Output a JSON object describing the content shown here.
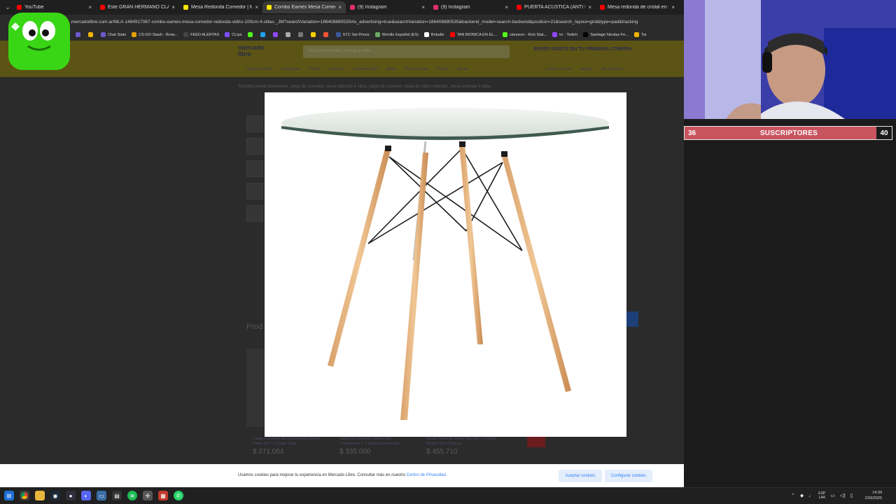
{
  "browser": {
    "tabs": [
      {
        "title": "YouTube",
        "color": "#ff0000"
      },
      {
        "title": "Este GRAN HERMANO CLANDE...",
        "color": "#ff0000"
      },
      {
        "title": "Mesa Redonda Comedor | Mer...",
        "color": "#ffe600"
      },
      {
        "title": "Combo Eames Mesa Comedor...",
        "color": "#ffe600",
        "active": true
      },
      {
        "title": "(9) Instagram",
        "color": "#e1306c"
      },
      {
        "title": "(9) Instagram",
        "color": "#e1306c"
      },
      {
        "title": "PUERTA ACÚSTICA (ANTI RUID...",
        "color": "#ff0000"
      },
      {
        "title": "Mesa redonda de cristal en liqu...",
        "color": "#ff0000"
      }
    ],
    "url": ".mercadolibre.com.ar/MLA-1464917067-combo-eames-mesa-comedor-redonda-vidrio-100cm-4-sillas-_JM?searchVariation=186408880535#is_advertising=true&searchVariation=186408880535&backend_model=search-backend&position=21&search_layout=grid&type=pad&tracking",
    "bookmarks": [
      {
        "label": "",
        "color": "#6a5acd"
      },
      {
        "label": "",
        "color": "#f0b400"
      },
      {
        "label": "Chat Stats",
        "color": "#6a5acd"
      },
      {
        "label": "CS:GO Stash - Brow...",
        "color": "#e0a000"
      },
      {
        "label": "FEED ALERTAS",
        "color": "#444"
      },
      {
        "label": "CLips",
        "color": "#7c4dff"
      },
      {
        "label": "",
        "color": "#53fc18"
      },
      {
        "label": "",
        "color": "#1da1f2"
      },
      {
        "label": "",
        "color": "#9146ff"
      },
      {
        "label": "",
        "color": "#aaaaaa"
      },
      {
        "label": "",
        "color": "#777777"
      },
      {
        "label": "",
        "color": "#ffd000"
      },
      {
        "label": "",
        "color": "#ff5533"
      },
      {
        "label": "STC Set Prices",
        "color": "#3b5998"
      },
      {
        "label": "Wordle Español (ES)",
        "color": "#6aaa64"
      },
      {
        "label": "Boludle",
        "color": "#ffffff"
      },
      {
        "label": "TAN BIONICA EN EL...",
        "color": "#ff0000"
      },
      {
        "label": "cionaron - Kick Stat...",
        "color": "#53fc18"
      },
      {
        "label": "trr - Twitch",
        "color": "#9146ff"
      },
      {
        "label": "Santiago Nicolas Fe...",
        "color": "#000000"
      },
      {
        "label": "Tai",
        "color": "#f0b400"
      }
    ]
  },
  "page": {
    "logo_line1": "mercado",
    "logo_line2": "libre",
    "search_placeholder": "Buscar productos, marcas y más...",
    "promo": "ENVÍO GRATIS  EN TU PRIMERA COMPRA",
    "nav": [
      "Capital Federal",
      "Categorías",
      "Ofertas",
      "Cupones",
      "Supermercado",
      "Moda",
      "Mercado Play",
      "Vender",
      "Ayuda"
    ],
    "nav_right": [
      "Creá tu cuenta",
      "Ingresá",
      "Mis compras"
    ],
    "breadcrumb": "También puede interesarte: juego de comedor, mesa redonda 4 sillas, juego de comedor mesa de vidrio redonda, mesa redonda 4 sillas",
    "related_title": "Prod",
    "cards": [
      {
        "title": "Juego Comedor Mesa Redonda Eames Vidrio 100 + 4 Sillas Tulip",
        "price": "$ 271.054"
      },
      {
        "title": "Juego De Comedor Mesa 100 Centimetros + 4 Sillas Eames Unid",
        "price": "$ 335.000"
      },
      {
        "title": "Juego Comedor Mesa Fija 100 + 4 Sillas Madrid Tela Chinese",
        "price": "$ 455.710"
      }
    ]
  },
  "cookie": {
    "text": "Usamos cookies para mejorar tu experiencia en Mercado Libre. Consultar más en nuestro ",
    "link": "Centro de Privacidad.",
    "accept": "Aceptar cookies",
    "configure": "Configurar cookies"
  },
  "stream": {
    "subs_current": "36",
    "subs_label": "SUSCRIPTORES",
    "subs_goal": "40"
  },
  "taskbar": {
    "lang_line1": "ESP",
    "lang_line2": "LAA",
    "time": "14:39",
    "date": "22/9/2025"
  }
}
